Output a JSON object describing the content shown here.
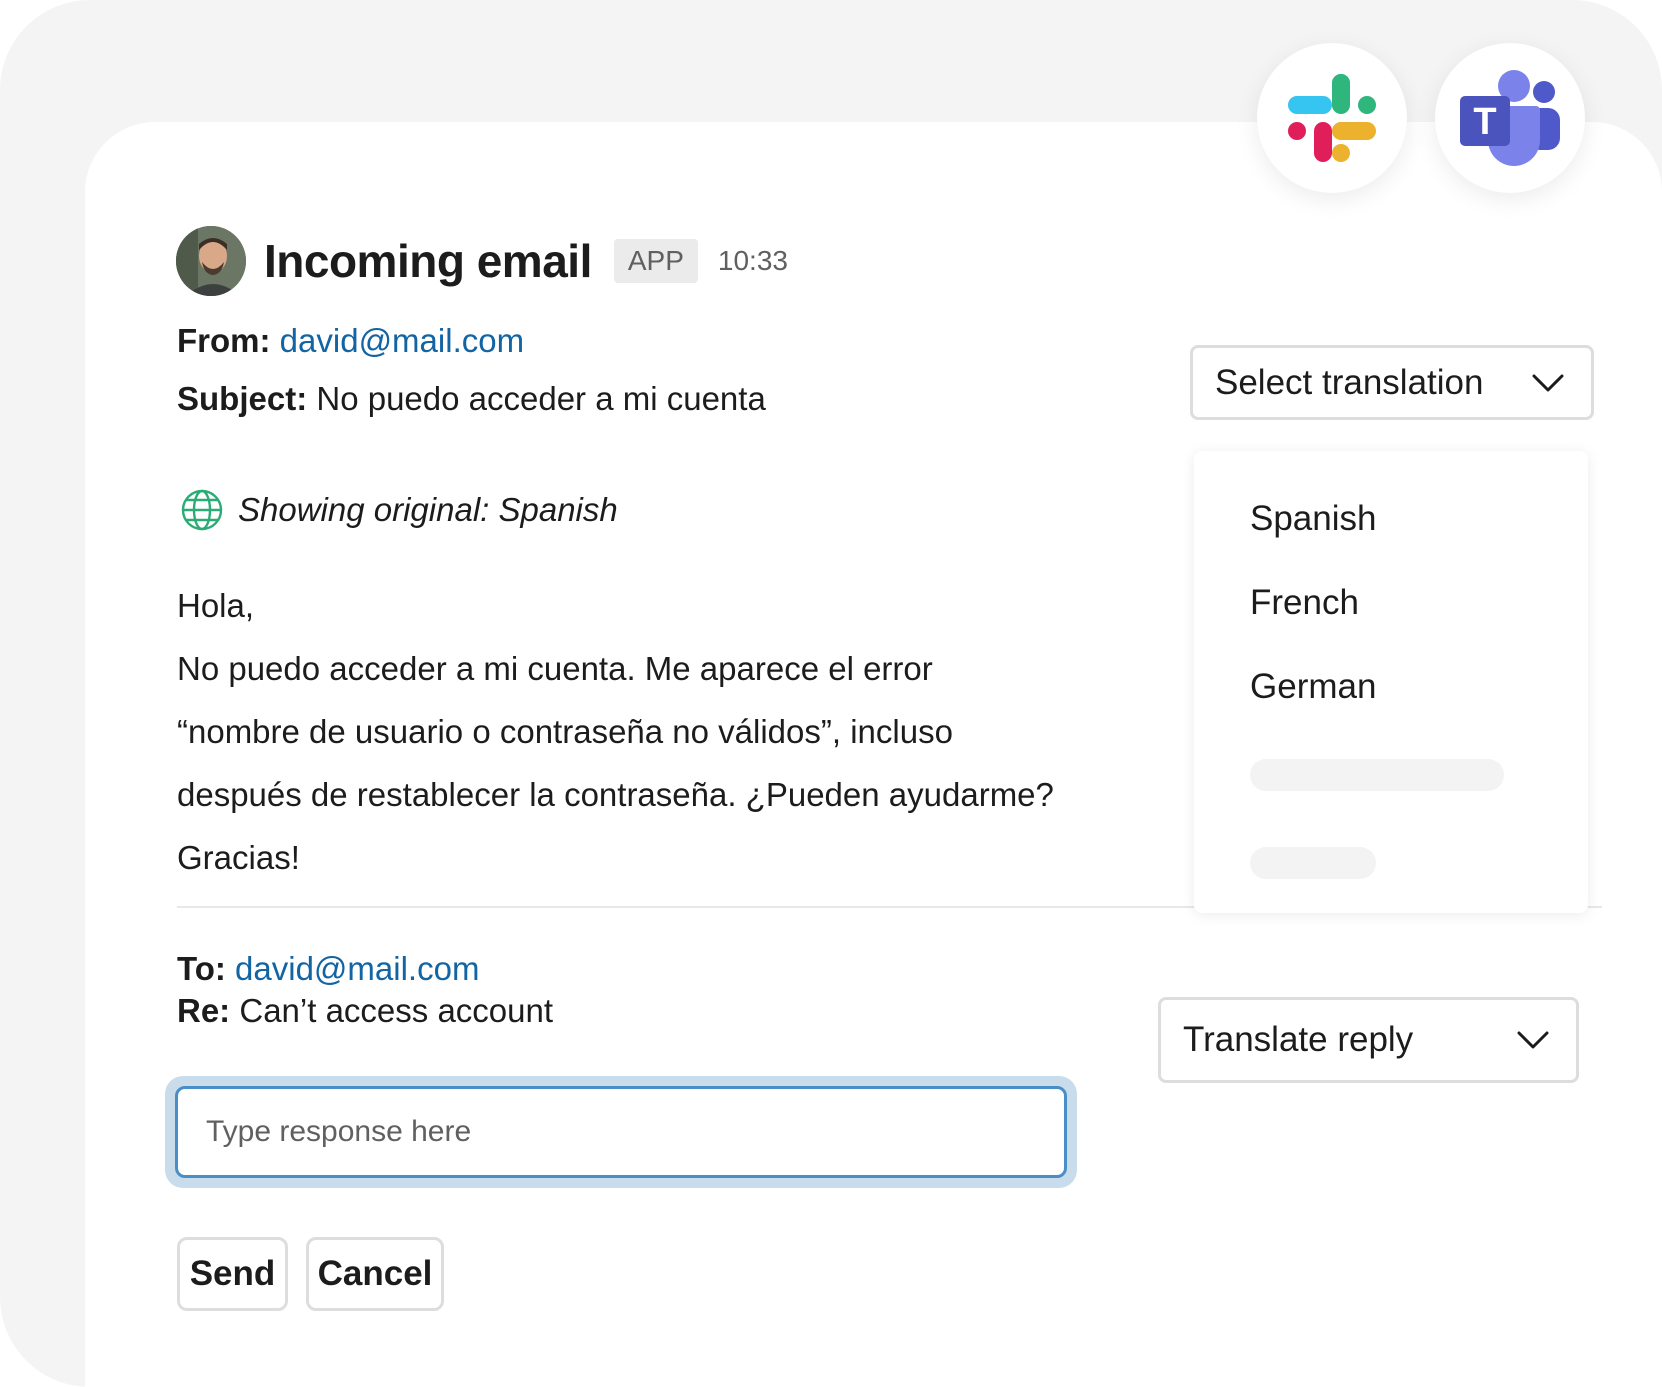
{
  "header": {
    "title": "Incoming email",
    "badge": "APP",
    "time": "10:33"
  },
  "apps": {
    "slack_icon": "slack-logo-icon",
    "teams_icon": "teams-logo-icon",
    "teams_letter": "T"
  },
  "email": {
    "from_label": "From:",
    "from_value": "david@mail.com",
    "subject_label": "Subject:",
    "subject_value": "No puedo acceder a mi cuenta",
    "original_notice": "Showing original: Spanish",
    "body": [
      "Hola,",
      "No puedo acceder a mi cuenta. Me aparece el error",
      "“nombre de usuario o contraseña no válidos”, incluso",
      "después de restablecer la contraseña. ¿Pueden ayudarme?",
      "Gracias!"
    ]
  },
  "translation": {
    "select_label": "Select translation",
    "options": [
      "Spanish",
      "French",
      "German"
    ]
  },
  "reply": {
    "to_label": "To:",
    "to_value": "david@mail.com",
    "re_label": "Re:",
    "re_value": "Can’t access account",
    "placeholder": "Type response here",
    "translate_label": "Translate reply",
    "send_label": "Send",
    "cancel_label": "Cancel"
  },
  "colors": {
    "link": "#1264a3",
    "focus": "#4a8ec8",
    "globe": "#2bac76"
  }
}
